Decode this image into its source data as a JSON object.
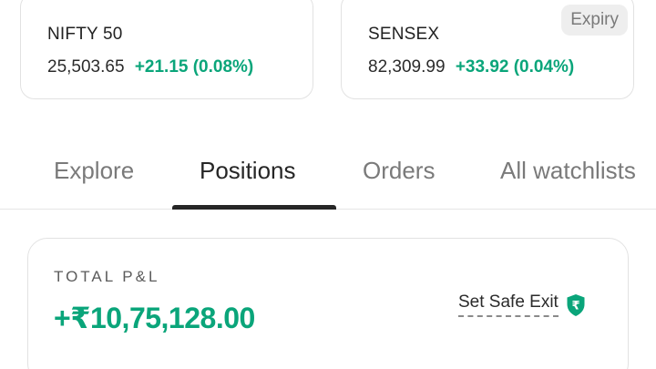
{
  "indices": [
    {
      "name": "NIFTY 50",
      "value": "25,503.65",
      "change": "+21.15 (0.08%)"
    },
    {
      "name": "SENSEX",
      "value": "82,309.99",
      "change": "+33.92 (0.04%)",
      "badge": "Expiry"
    }
  ],
  "tabs": [
    {
      "label": "Explore",
      "active": false
    },
    {
      "label": "Positions",
      "active": true
    },
    {
      "label": "Orders",
      "active": false
    },
    {
      "label": "All watchlists",
      "active": false
    }
  ],
  "pnl": {
    "label": "TOTAL P&L",
    "value": "+₹10,75,128.00",
    "safe_exit_label": "Set Safe Exit",
    "safe_exit_icon": "rupee-shield-icon"
  },
  "colors": {
    "positive": "#0aa57a",
    "tab_active": "#262626",
    "tab_inactive": "#7a7a7a"
  }
}
